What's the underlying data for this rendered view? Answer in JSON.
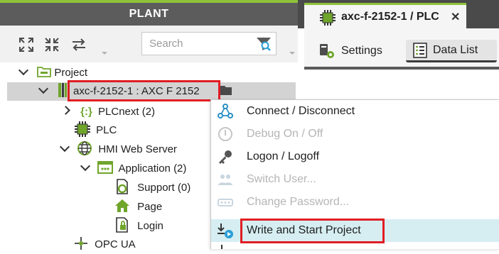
{
  "plant": {
    "title": "PLANT",
    "search_placeholder": "Search"
  },
  "tree": {
    "project": "Project",
    "device": "axc-f-2152-1 : AXC F 2152",
    "plcnext": "PLCnext (2)",
    "plc": "PLC",
    "hmi": "HMI Web Server",
    "application": "Application (2)",
    "support": "Support (0)",
    "page": "Page",
    "login": "Login",
    "opcua": "OPC UA"
  },
  "editor": {
    "tab_title": "axc-f-2152-1 / PLC",
    "close_glyph": "✕",
    "subtabs": [
      "Settings",
      "Data List"
    ]
  },
  "context_menu": {
    "items": [
      {
        "label": "Connect / Disconnect",
        "enabled": true,
        "icon": "network-icon"
      },
      {
        "label": "Debug On / Off",
        "enabled": false,
        "icon": "debug-icon"
      },
      {
        "label": "Logon / Logoff",
        "enabled": true,
        "icon": "key-icon"
      },
      {
        "label": "Switch User...",
        "enabled": false,
        "icon": "switch-user-icon"
      },
      {
        "label": "Change Password...",
        "enabled": false,
        "icon": "change-password-icon"
      },
      {
        "label": "Write and Start Project",
        "enabled": true,
        "icon": "write-start-icon"
      }
    ]
  },
  "colors": {
    "accent_green": "#8fc23a",
    "highlight_red": "#e01e24",
    "menu_highlight": "#d6eef2"
  }
}
